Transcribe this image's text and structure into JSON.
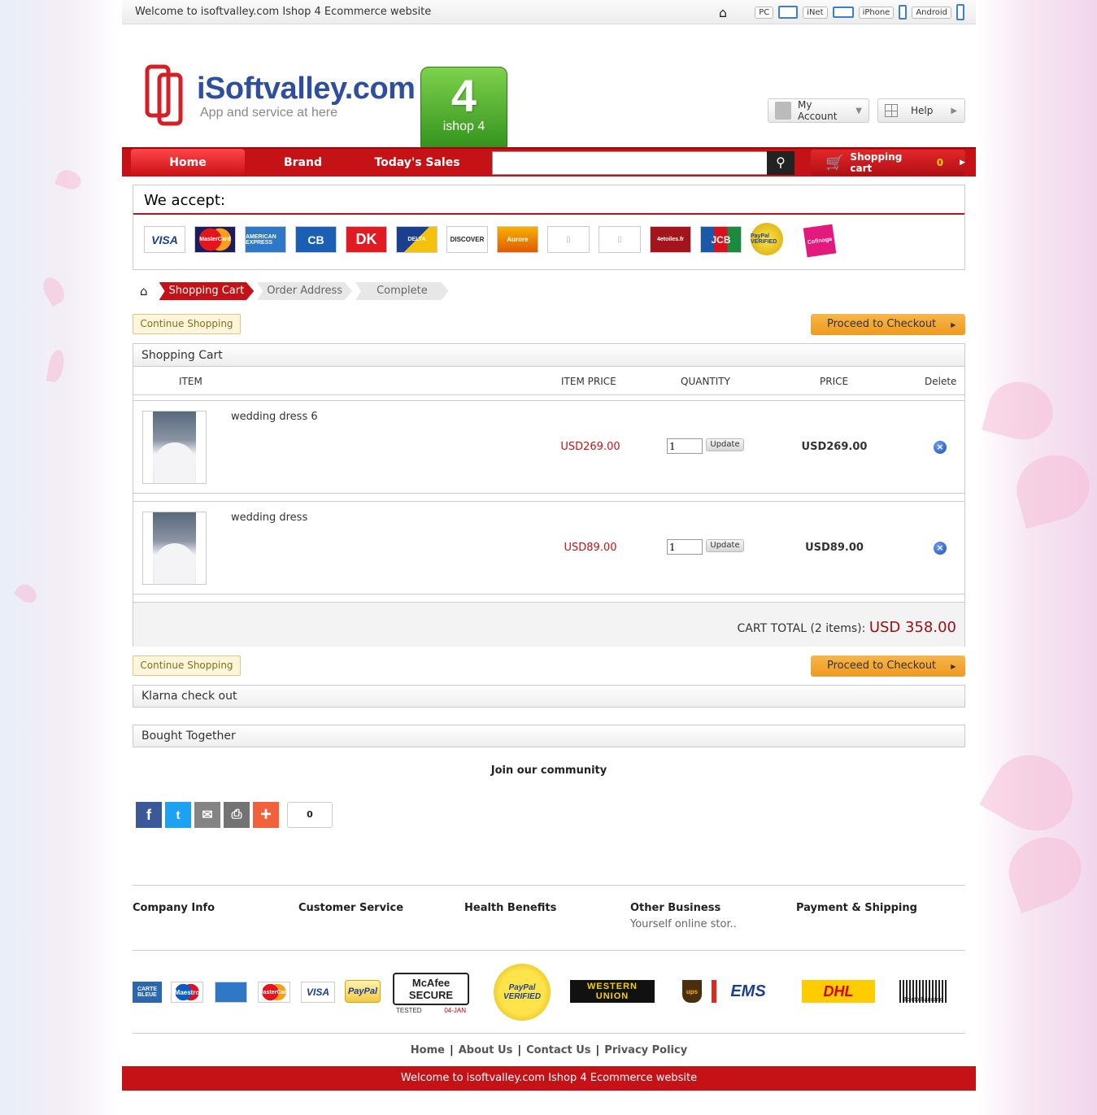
{
  "topbar": {
    "welcome": "Welcome to isoftvalley.com Ishop 4 Ecommerce website",
    "devices": [
      {
        "label": "PC"
      },
      {
        "label": "iNet"
      },
      {
        "label": "iPhone"
      },
      {
        "label": "Android"
      }
    ]
  },
  "header": {
    "logo_name": "iSoftvalley.com",
    "logo_tagline": "App and service at here",
    "badge_number": "4",
    "badge_text": "ishop 4",
    "my_account": "My Account",
    "help": "Help"
  },
  "nav": {
    "home": "Home",
    "brand": "Brand",
    "todays_sales": "Today's Sales",
    "search_placeholder": "",
    "cart_label": "Shopping cart",
    "cart_count": "0"
  },
  "accept": {
    "title": "We accept:",
    "cards": [
      "VISA",
      "MasterCard",
      "AMERICAN EXPRESS",
      "CB",
      "DK",
      "DELTA",
      "DISCOVER",
      "Aurore",
      "",
      "",
      "4etoiles.fr",
      "JCB",
      "PayPal VERIFIED",
      "Cofinoga"
    ]
  },
  "breadcrumb": {
    "steps": [
      "Shopping Cart",
      "Order Address",
      "Complete"
    ]
  },
  "buttons": {
    "continue": "Continue Shopping",
    "checkout": "Proceed to Checkout"
  },
  "cart": {
    "title": "Shopping Cart",
    "columns": {
      "item": "ITEM",
      "item_price": "ITEM PRICE",
      "quantity": "QUANTITY",
      "price": "PRICE",
      "delete": "Delete"
    },
    "rows": [
      {
        "name": "wedding dress 6",
        "item_price": "USD269.00",
        "qty": "1",
        "update": "Update",
        "price": "USD269.00"
      },
      {
        "name": "wedding dress",
        "item_price": "USD89.00",
        "qty": "1",
        "update": "Update",
        "price": "USD89.00"
      }
    ],
    "total_label": "CART TOTAL (2 items):",
    "total_amount": "USD 358.00"
  },
  "panels": {
    "klarna": "Klarna check out",
    "bought_together": "Bought Together"
  },
  "community": {
    "title": "Join our community",
    "share_count": "0"
  },
  "footer": {
    "columns": [
      "Company Info",
      "Customer Service",
      "Health Benefits",
      "Other Business",
      "Payment & Shipping"
    ],
    "other_business_sub": "Yourself online stor..",
    "payment_logos": [
      "CARTE BLEUE",
      "Maestro",
      "",
      "MasterCard",
      "VISA",
      "PayPal",
      "McAfee SECURE",
      "TESTED",
      "04-JAN",
      "PayPal VERIFIED",
      "WESTERN UNION",
      "ups",
      "EMS",
      "DHL",
      "Boleto Bancário"
    ],
    "links": [
      "Home",
      "About Us",
      "Contact Us",
      "Privacy Policy"
    ],
    "bottom_text": "Welcome to isoftvalley.com Ishop 4 Ecommerce website"
  },
  "colors": {
    "brand_red": "#c41217",
    "checkout_orange": "#ee9a1f",
    "price_red": "#c41217"
  }
}
